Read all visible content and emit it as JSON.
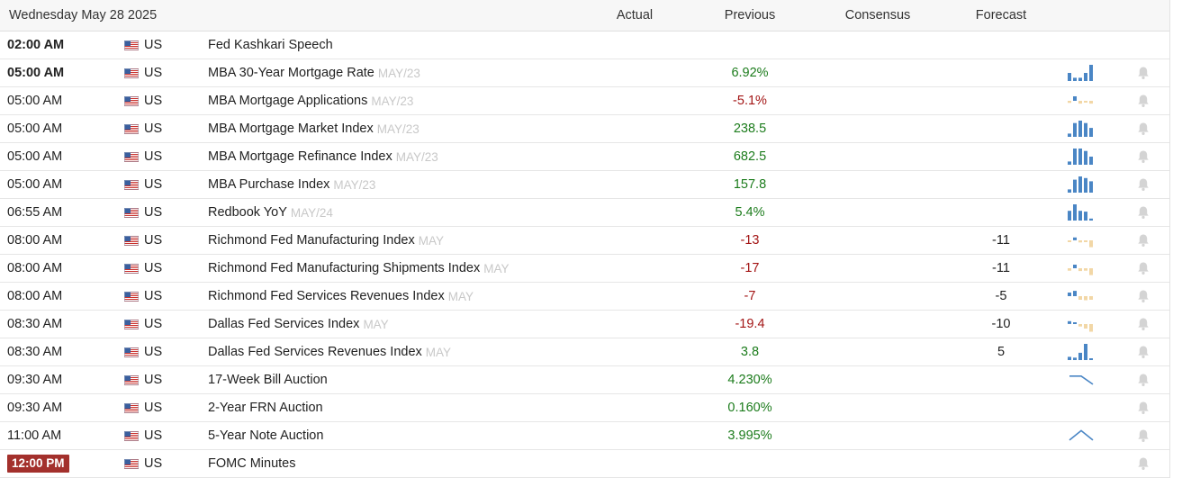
{
  "header": {
    "date": "Wednesday May 28 2025",
    "actual": "Actual",
    "previous": "Previous",
    "consensus": "Consensus",
    "forecast": "Forecast"
  },
  "colors": {
    "positive": "#1c7c1c",
    "negative": "#a31515",
    "chart_blue": "#4a86c5",
    "chart_tan": "#f2d7a6",
    "badge": "#a3302c",
    "bell": "#d4d4d4"
  },
  "events": [
    {
      "time": "02:00 AM",
      "time_style": "bold",
      "country": "US",
      "event": "Fed Kashkari Speech",
      "period": "",
      "actual": "",
      "previous": "",
      "previous_sign": "",
      "consensus": "",
      "forecast": "",
      "chart": "none"
    },
    {
      "time": "05:00 AM",
      "time_style": "bold",
      "country": "US",
      "event": "MBA 30-Year Mortgage Rate",
      "period": "MAY/23",
      "actual": "",
      "previous": "6.92%",
      "previous_sign": "pos",
      "consensus": "",
      "forecast": "",
      "chart": "bars",
      "bars": [
        {
          "v": 0.5,
          "c": "blue"
        },
        {
          "v": 0.2,
          "c": "blue"
        },
        {
          "v": 0.2,
          "c": "blue"
        },
        {
          "v": 0.5,
          "c": "blue"
        },
        {
          "v": 1.0,
          "c": "blue"
        }
      ]
    },
    {
      "time": "05:00 AM",
      "time_style": "",
      "country": "US",
      "event": "MBA Mortgage Applications",
      "period": "MAY/23",
      "actual": "",
      "previous": "-5.1%",
      "previous_sign": "neg",
      "consensus": "",
      "forecast": "",
      "chart": "bars",
      "bars": [
        {
          "v": -0.25,
          "c": "tan"
        },
        {
          "v": 0.55,
          "c": "blue"
        },
        {
          "v": -0.35,
          "c": "tan"
        },
        {
          "v": -0.15,
          "c": "tan"
        },
        {
          "v": -0.35,
          "c": "tan"
        }
      ]
    },
    {
      "time": "05:00 AM",
      "time_style": "",
      "country": "US",
      "event": "MBA Mortgage Market Index",
      "period": "MAY/23",
      "actual": "",
      "previous": "238.5",
      "previous_sign": "pos",
      "consensus": "",
      "forecast": "",
      "chart": "bars",
      "bars": [
        {
          "v": 0.2,
          "c": "blue"
        },
        {
          "v": 0.85,
          "c": "blue"
        },
        {
          "v": 1.0,
          "c": "blue"
        },
        {
          "v": 0.85,
          "c": "blue"
        },
        {
          "v": 0.55,
          "c": "blue"
        }
      ]
    },
    {
      "time": "05:00 AM",
      "time_style": "",
      "country": "US",
      "event": "MBA Mortgage Refinance Index",
      "period": "MAY/23",
      "actual": "",
      "previous": "682.5",
      "previous_sign": "pos",
      "consensus": "",
      "forecast": "",
      "chart": "bars",
      "bars": [
        {
          "v": 0.2,
          "c": "blue"
        },
        {
          "v": 1.0,
          "c": "blue"
        },
        {
          "v": 1.0,
          "c": "blue"
        },
        {
          "v": 0.85,
          "c": "blue"
        },
        {
          "v": 0.5,
          "c": "blue"
        }
      ]
    },
    {
      "time": "05:00 AM",
      "time_style": "",
      "country": "US",
      "event": "MBA Purchase Index",
      "period": "MAY/23",
      "actual": "",
      "previous": "157.8",
      "previous_sign": "pos",
      "consensus": "",
      "forecast": "",
      "chart": "bars",
      "bars": [
        {
          "v": 0.2,
          "c": "blue"
        },
        {
          "v": 0.8,
          "c": "blue"
        },
        {
          "v": 1.0,
          "c": "blue"
        },
        {
          "v": 0.9,
          "c": "blue"
        },
        {
          "v": 0.7,
          "c": "blue"
        }
      ]
    },
    {
      "time": "06:55 AM",
      "time_style": "",
      "country": "US",
      "event": "Redbook YoY",
      "period": "MAY/24",
      "actual": "",
      "previous": "5.4%",
      "previous_sign": "pos",
      "consensus": "",
      "forecast": "",
      "chart": "bars",
      "bars": [
        {
          "v": 0.6,
          "c": "blue"
        },
        {
          "v": 1.0,
          "c": "blue"
        },
        {
          "v": 0.6,
          "c": "blue"
        },
        {
          "v": 0.55,
          "c": "blue"
        },
        {
          "v": 0.12,
          "c": "blue"
        }
      ]
    },
    {
      "time": "08:00 AM",
      "time_style": "",
      "country": "US",
      "event": "Richmond Fed Manufacturing Index",
      "period": "MAY",
      "actual": "",
      "previous": "-13",
      "previous_sign": "neg",
      "consensus": "",
      "forecast": "-11",
      "chart": "bars",
      "bars": [
        {
          "v": -0.2,
          "c": "tan"
        },
        {
          "v": 0.35,
          "c": "blue"
        },
        {
          "v": -0.25,
          "c": "tan"
        },
        {
          "v": -0.2,
          "c": "tan"
        },
        {
          "v": -0.85,
          "c": "tan"
        }
      ]
    },
    {
      "time": "08:00 AM",
      "time_style": "",
      "country": "US",
      "event": "Richmond Fed Manufacturing Shipments Index",
      "period": "MAY",
      "actual": "",
      "previous": "-17",
      "previous_sign": "neg",
      "consensus": "",
      "forecast": "-11",
      "chart": "bars",
      "bars": [
        {
          "v": -0.3,
          "c": "tan"
        },
        {
          "v": 0.45,
          "c": "blue"
        },
        {
          "v": -0.35,
          "c": "tan"
        },
        {
          "v": -0.3,
          "c": "tan"
        },
        {
          "v": -0.85,
          "c": "tan"
        }
      ]
    },
    {
      "time": "08:00 AM",
      "time_style": "",
      "country": "US",
      "event": "Richmond Fed Services Revenues Index",
      "period": "MAY",
      "actual": "",
      "previous": "-7",
      "previous_sign": "neg",
      "consensus": "",
      "forecast": "-5",
      "chart": "bars",
      "bars": [
        {
          "v": 0.45,
          "c": "blue"
        },
        {
          "v": 0.65,
          "c": "blue"
        },
        {
          "v": -0.45,
          "c": "tan"
        },
        {
          "v": -0.5,
          "c": "tan"
        },
        {
          "v": -0.45,
          "c": "tan"
        }
      ]
    },
    {
      "time": "08:30 AM",
      "time_style": "",
      "country": "US",
      "event": "Dallas Fed Services Index",
      "period": "MAY",
      "actual": "",
      "previous": "-19.4",
      "previous_sign": "neg",
      "consensus": "",
      "forecast": "-10",
      "chart": "bars",
      "bars": [
        {
          "v": 0.35,
          "c": "blue"
        },
        {
          "v": 0.15,
          "c": "blue"
        },
        {
          "v": -0.3,
          "c": "tan"
        },
        {
          "v": -0.55,
          "c": "tan"
        },
        {
          "v": -0.95,
          "c": "tan"
        }
      ]
    },
    {
      "time": "08:30 AM",
      "time_style": "",
      "country": "US",
      "event": "Dallas Fed Services Revenues Index",
      "period": "MAY",
      "actual": "",
      "previous": "3.8",
      "previous_sign": "pos",
      "consensus": "",
      "forecast": "5",
      "chart": "bars",
      "bars": [
        {
          "v": 0.2,
          "c": "blue"
        },
        {
          "v": 0.15,
          "c": "blue"
        },
        {
          "v": 0.45,
          "c": "blue"
        },
        {
          "v": 1.0,
          "c": "blue"
        },
        {
          "v": 0.1,
          "c": "blue"
        }
      ]
    },
    {
      "time": "09:30 AM",
      "time_style": "",
      "country": "US",
      "event": "17-Week Bill Auction",
      "period": "",
      "actual": "",
      "previous": "4.230%",
      "previous_sign": "pos",
      "consensus": "",
      "forecast": "",
      "chart": "line",
      "line": [
        0.8,
        0.8,
        0.15
      ]
    },
    {
      "time": "09:30 AM",
      "time_style": "",
      "country": "US",
      "event": "2-Year FRN Auction",
      "period": "",
      "actual": "",
      "previous": "0.160%",
      "previous_sign": "pos",
      "consensus": "",
      "forecast": "",
      "chart": "none"
    },
    {
      "time": "11:00 AM",
      "time_style": "",
      "country": "US",
      "event": "5-Year Note Auction",
      "period": "",
      "actual": "",
      "previous": "3.995%",
      "previous_sign": "pos",
      "consensus": "",
      "forecast": "",
      "chart": "line",
      "line": [
        0.15,
        0.9,
        0.15
      ]
    },
    {
      "time": "12:00 PM",
      "time_style": "badge",
      "country": "US",
      "event": "FOMC Minutes",
      "period": "",
      "actual": "",
      "previous": "",
      "previous_sign": "",
      "consensus": "",
      "forecast": "",
      "chart": "none"
    }
  ]
}
